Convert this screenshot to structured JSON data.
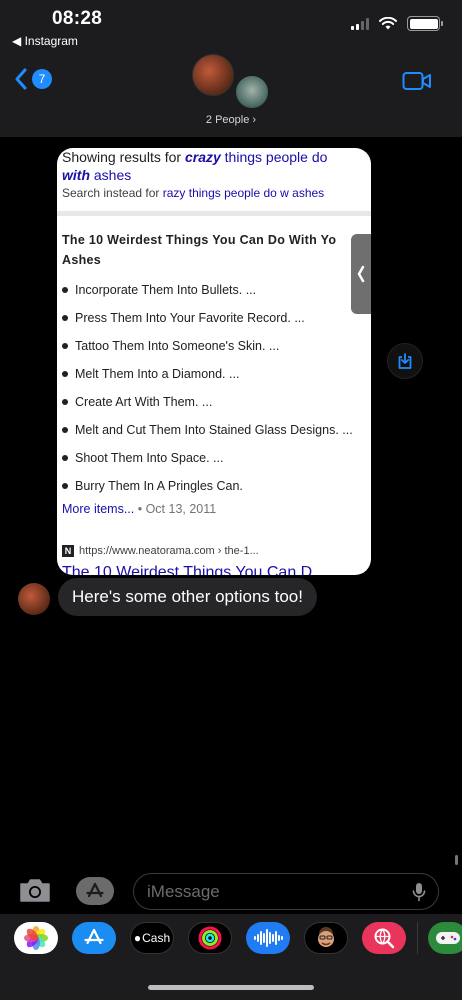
{
  "status_bar": {
    "time": "08:28",
    "back_app": "◀ Instagram"
  },
  "header": {
    "back_badge_count": "7",
    "people_label": "2 People ›"
  },
  "card": {
    "spell_prefix": "Showing results for ",
    "spell_bold": "crazy",
    "spell_mid": " things people do ",
    "spell_bold2": "with",
    "spell_end": " ashes",
    "instead_prefix": "Search instead for ",
    "instead_link": "razy things people do w ashes",
    "snippet_title": "The 10 Weirdest Things You Can Do With Yo Ashes",
    "items": [
      "Incorporate Them Into Bullets. ...",
      "Press Them Into Your Favorite Record. ...",
      "Tattoo Them Into Someone's Skin. ...",
      "Melt Them Into a Diamond. ...",
      "Create Art With Them. ...",
      "Melt and Cut Them Into Stained Glass Designs. ...",
      "Shoot Them Into Space. ...",
      "Burry Them In A Pringles Can."
    ],
    "more_link": "More items...",
    "date": " • Oct 13, 2011",
    "source_logo": "N",
    "source_url": "https://www.neatorama.com › the-1...",
    "cut_title": "The 10 Weirdest Things You Can D"
  },
  "message": {
    "text": "Here's some other options  too!"
  },
  "composer": {
    "placeholder": "iMessage"
  },
  "tray": {
    "cash_label": "Cash"
  },
  "colors": {
    "accent": "#1f8cff",
    "link": "#1a0dab"
  }
}
